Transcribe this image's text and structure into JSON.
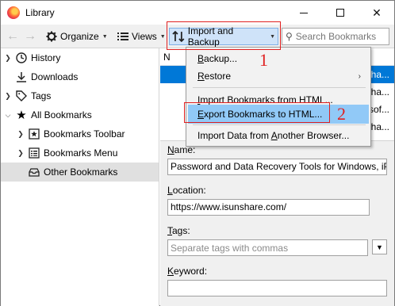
{
  "window": {
    "title": "Library",
    "controls": {
      "minimize": "minimize",
      "maximize": "maximize",
      "close": "✕"
    }
  },
  "toolbar": {
    "organize_label": "Organize",
    "views_label": "Views",
    "import_backup_label": "Import and Backup",
    "search_placeholder": "Search Bookmarks"
  },
  "tree": {
    "items": [
      {
        "label": "History",
        "icon": "clock-icon",
        "has_twisty": true
      },
      {
        "label": "Downloads",
        "icon": "download-icon",
        "has_twisty": false
      },
      {
        "label": "Tags",
        "icon": "tag-icon",
        "has_twisty": true
      },
      {
        "label": "All Bookmarks",
        "icon": "star-icon",
        "has_twisty": true,
        "expanded": true
      },
      {
        "label": "Bookmarks Toolbar",
        "icon": "toolbar-star-icon",
        "has_twisty": true
      },
      {
        "label": "Bookmarks Menu",
        "icon": "menu-list-icon",
        "has_twisty": true
      },
      {
        "label": "Other Bookmarks",
        "icon": "folder-tray-icon",
        "has_twisty": false,
        "selected": true
      }
    ]
  },
  "list": {
    "header_name": "N",
    "rows": [
      {
        "text": "sha...",
        "selected": true
      },
      {
        "text": "sha...",
        "selected": false
      },
      {
        "text": "asof...",
        "selected": false
      },
      {
        "text": "sha...",
        "selected": false
      }
    ]
  },
  "menu": {
    "items": [
      {
        "label": "Backup...",
        "underline": "B",
        "rest": "ackup..."
      },
      {
        "label": "Restore",
        "underline": "R",
        "rest": "estore",
        "has_submenu": true
      },
      {
        "label": "Import Bookmarks from HTML...",
        "underline": "I",
        "rest": "mport Bookmarks from HTML..."
      },
      {
        "label": "Export Bookmarks to HTML...",
        "underline": "E",
        "rest": "xport Bookmarks to HTML...",
        "hover": true
      },
      {
        "label": "Import Data from Another Browser...",
        "prefix": "Import Data from ",
        "underline": "A",
        "rest": "nother Browser..."
      }
    ],
    "submenu_arrow": "›"
  },
  "callouts": {
    "one": "1",
    "two": "2"
  },
  "details": {
    "name_label": "Name:",
    "name_label_u": "N",
    "name_label_rest": "ame:",
    "name_value": "Password and Data Recovery Tools for Windows, iPhone",
    "location_label": "Location:",
    "location_label_u": "L",
    "location_label_rest": "ocation:",
    "location_value": "https://www.isunshare.com/",
    "tags_label": "Tags:",
    "tags_label_u": "T",
    "tags_label_rest": "ags:",
    "tags_placeholder": "Separate tags with commas",
    "keyword_label": "Keyword:",
    "keyword_label_u": "K",
    "keyword_label_rest": "eyword:",
    "keyword_value": ""
  },
  "colors": {
    "accent": "#0078d7",
    "menu_hover": "#91c9f7",
    "annotation_red": "#e02020",
    "button_active": "#cfe3f9"
  }
}
